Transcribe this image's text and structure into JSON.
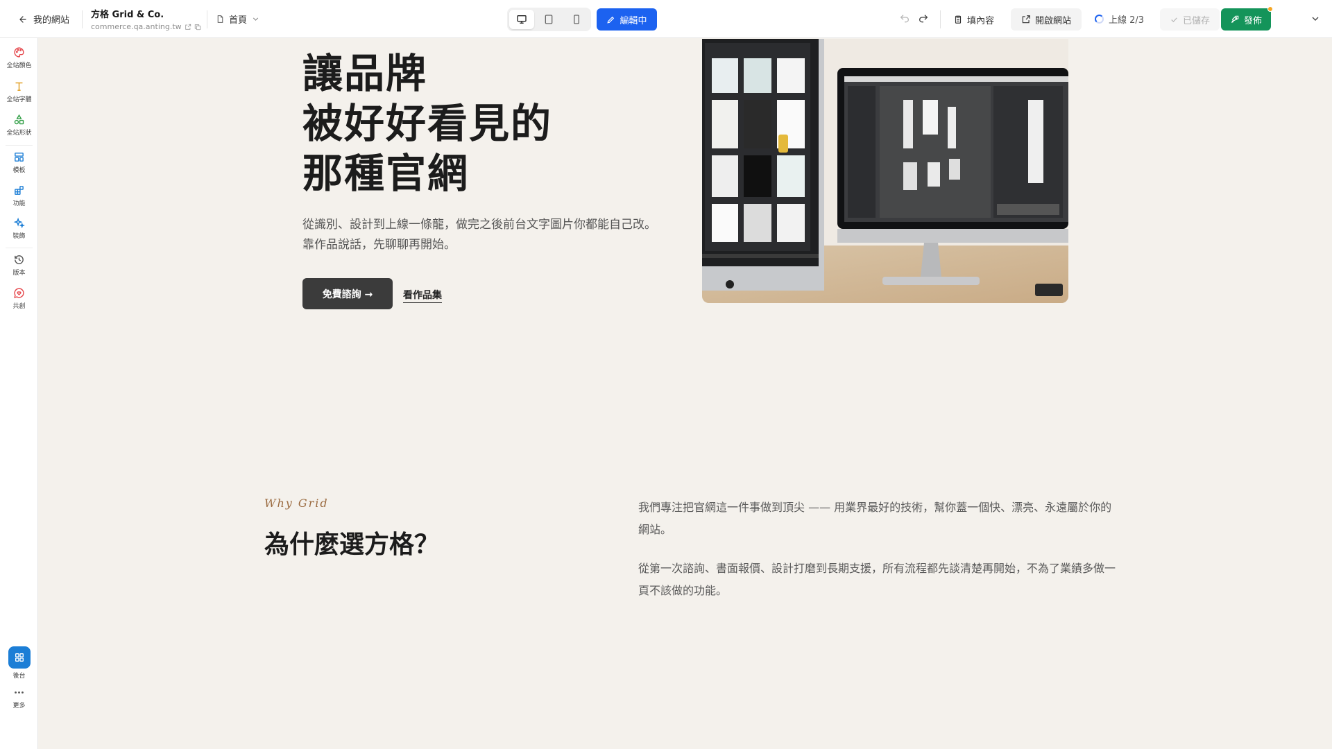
{
  "topbar": {
    "back_label": "我的網站",
    "site_name": "方格 Grid & Co.",
    "site_domain": "commerce.qa.anting.tw",
    "page_label": "首頁",
    "devices": [
      "desktop",
      "tablet",
      "mobile"
    ],
    "active_device": "desktop",
    "edit_label": "編輯中",
    "fill_content_label": "填內容",
    "open_site_label": "開啟網站",
    "upload_status": "上線 2/3",
    "saved_label": "已儲存",
    "publish_label": "發佈",
    "colors": {
      "edit": "#1c62f0",
      "publish": "#14945a",
      "notify_dot": "#f5a623"
    }
  },
  "leftrail": {
    "items": [
      {
        "label": "全站顏色",
        "icon": "palette-icon",
        "color": "#e5484d"
      },
      {
        "label": "全站字體",
        "icon": "type-icon",
        "color": "#e09b1a"
      },
      {
        "label": "全站形狀",
        "icon": "shapes-icon",
        "color": "#2f9e44"
      },
      {
        "label": "模板",
        "icon": "layout-icon",
        "color": "#1c7ed6"
      },
      {
        "label": "功能",
        "icon": "blocks-icon",
        "color": "#1c7ed6"
      },
      {
        "label": "裝飾",
        "icon": "sparkles-icon",
        "color": "#1c7ed6"
      },
      {
        "label": "版本",
        "icon": "history-icon",
        "color": "#555555"
      },
      {
        "label": "共創",
        "icon": "chat-heart-icon",
        "color": "#e5484d"
      }
    ],
    "backend_label": "後台",
    "more_label": "更多"
  },
  "hero": {
    "title_lines": [
      "讓品牌",
      "被好好看見的",
      "那種官網"
    ],
    "subtitle": "從識別、設計到上線一條龍，做完之後前台文字圖片你都能自己改。靠作品說話，先聊聊再開始。",
    "cta_primary": "免費諮詢 →",
    "cta_secondary": "看作品集"
  },
  "why": {
    "eyebrow": "Why Grid",
    "title": "為什麼選方格？",
    "paragraphs": [
      "我們專注把官網這一件事做到頂尖 —— 用業界最好的技術，幫你蓋一個快、漂亮、永遠屬於你的網站。",
      "從第一次諮詢、書面報價、設計打磨到長期支援，所有流程都先談清楚再開始，不為了業績多做一頁不該做的功能。"
    ]
  }
}
